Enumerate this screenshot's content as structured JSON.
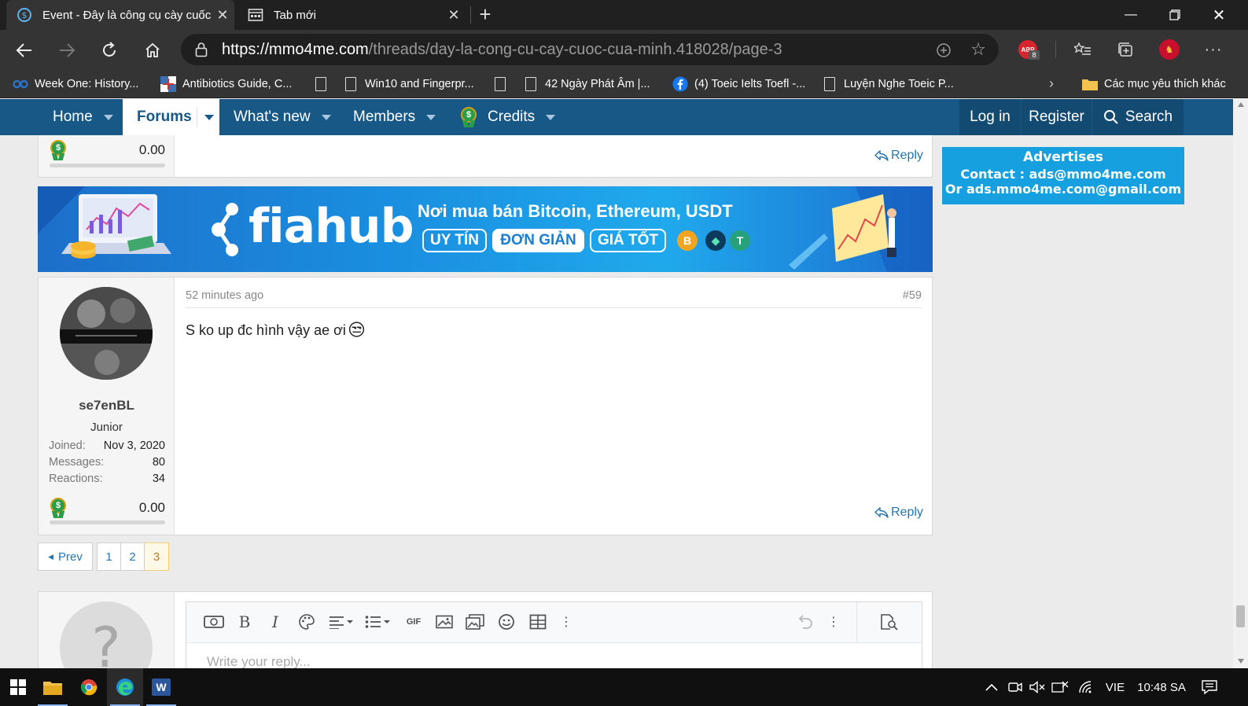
{
  "browser": {
    "tabs": [
      {
        "title": "Event - Đây là công cụ cày cuốc c",
        "active": true
      },
      {
        "title": "Tab mới",
        "active": false
      }
    ],
    "url_scheme": "https://",
    "url_host": "mmo4me.com",
    "url_path": "/threads/day-la-cong-cu-cay-cuoc-cua-minh.418028/page-3",
    "ext_badge": "8",
    "ext_label": "ABP",
    "bookmarks": [
      "Week One: History...",
      "Antibiotics Guide, C...",
      "Win10 and Fingerpr...",
      "42 Ngày Phát Âm |...",
      "(4) Toeic Ielts Toefl -...",
      "Luyện Nghe Toeic P...",
      "Các mục yêu thích khác"
    ]
  },
  "site_nav": {
    "items": [
      "Home",
      "Forums",
      "What's new",
      "Members",
      "Credits"
    ],
    "active": "Forums",
    "right": [
      "Log in",
      "Register",
      "Search"
    ]
  },
  "prev_post": {
    "credits": "0.00",
    "reply_label": "Reply"
  },
  "banner": {
    "brand": "fiahub",
    "headline": "Nơi mua bán Bitcoin, Ethereum, USDT",
    "pills": [
      "UY TÍN",
      "ĐƠN GIẢN",
      "GIÁ TỐT"
    ],
    "coins": [
      "B",
      "◆",
      "T"
    ]
  },
  "ad": {
    "line1": "Advertises",
    "line2": "Contact : ads@mmo4me.com",
    "line3": "Or ads.mmo4me.com@gmail.com"
  },
  "post": {
    "time": "52 minutes ago",
    "number": "#59",
    "body": "S ko up đc hình vậy ae ơi",
    "emoji": "😒",
    "reply_label": "Reply",
    "user": {
      "name": "se7enBL",
      "title": "Junior",
      "stats": [
        {
          "label": "Joined:",
          "value": "Nov 3, 2020"
        },
        {
          "label": "Messages:",
          "value": "80"
        },
        {
          "label": "Reactions:",
          "value": "34"
        }
      ],
      "credits": "0.00"
    }
  },
  "pagination": {
    "prev": "Prev",
    "pages": [
      "1",
      "2",
      "3"
    ],
    "current": "3"
  },
  "editor": {
    "placeholder": "Write your reply...",
    "avatar_glyph": "?"
  },
  "taskbar": {
    "lang": "VIE",
    "time": "10:48 SA"
  }
}
